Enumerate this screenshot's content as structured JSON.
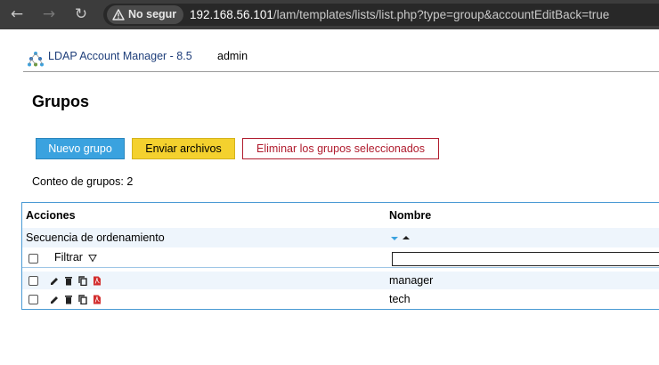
{
  "browser": {
    "security_label": "No segur",
    "url_host": "192.168.56.101",
    "url_path": "/lam/templates/lists/list.php?type=group&accountEditBack=true"
  },
  "header": {
    "app_title": "LDAP Account Manager - 8.5",
    "user": "admin"
  },
  "page": {
    "title": "Grupos",
    "count_label": "Conteo de grupos: 2"
  },
  "toolbar": {
    "new_label": "Nuevo grupo",
    "upload_label": "Enviar archivos",
    "delete_label": "Eliminar los grupos seleccionados"
  },
  "colors": {
    "new_button": "#3aa2df",
    "upload_button": "#f4d12e",
    "delete_button_border": "#b01c2e",
    "row_highlight": "#eef5fc",
    "table_border": "#4a9ad4",
    "pdf_icon": "#d32f2f"
  },
  "table": {
    "headers": {
      "actions": "Acciones",
      "name": "Nombre"
    },
    "sort_label": "Secuencia de ordenamiento",
    "filter_label": "Filtrar",
    "row_icons": [
      "edit-icon",
      "delete-icon",
      "copy-icon",
      "pdf-icon"
    ],
    "rows": [
      {
        "name": "manager"
      },
      {
        "name": "tech"
      }
    ]
  }
}
